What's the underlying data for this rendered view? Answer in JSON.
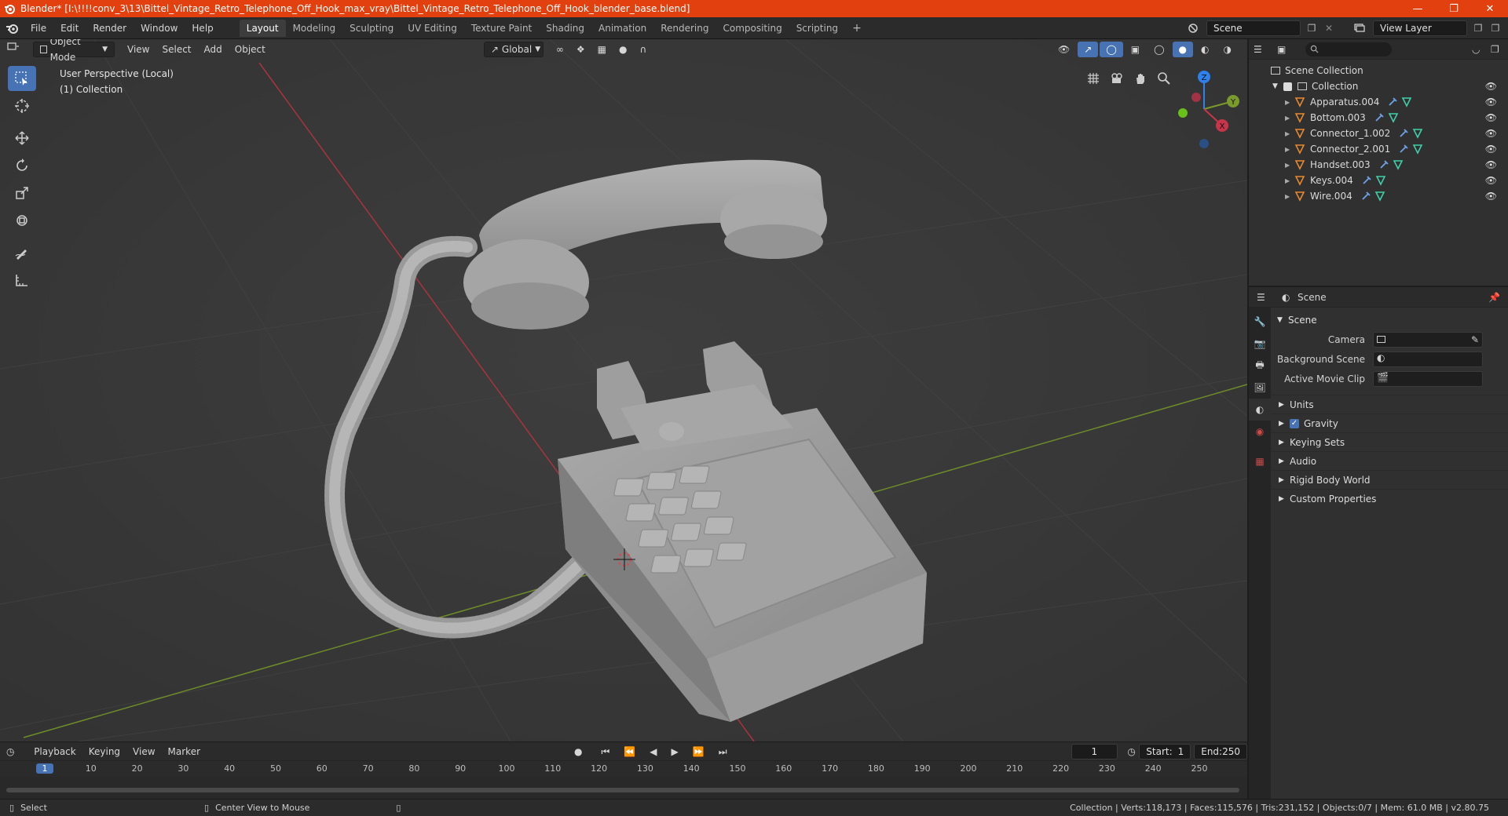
{
  "window": {
    "title": "Blender* [I:\\!!!!conv_3\\13\\Bittel_Vintage_Retro_Telephone_Off_Hook_max_vray\\Bittel_Vintage_Retro_Telephone_Off_Hook_blender_base.blend]"
  },
  "menu": [
    "File",
    "Edit",
    "Render",
    "Window",
    "Help"
  ],
  "workspaces": [
    "Layout",
    "Modeling",
    "Sculpting",
    "UV Editing",
    "Texture Paint",
    "Shading",
    "Animation",
    "Rendering",
    "Compositing",
    "Scripting"
  ],
  "active_workspace": "Layout",
  "scene_name": "Scene",
  "view_layer": "View Layer",
  "viewport": {
    "mode": "Object Mode",
    "menus": [
      "View",
      "Select",
      "Add",
      "Object"
    ],
    "orientation": "Global",
    "info_line1": "User Perspective (Local)",
    "info_line2": "(1) Collection",
    "gizmo": {
      "z": "Z",
      "y": "Y",
      "x": "X"
    }
  },
  "outliner": {
    "root": "Scene Collection",
    "collection": "Collection",
    "objects": [
      "Apparatus.004",
      "Bottom.003",
      "Connector_1.002",
      "Connector_2.001",
      "Handset.003",
      "Keys.004",
      "Wire.004"
    ]
  },
  "properties": {
    "header": "Scene",
    "panel": "Scene",
    "fields": [
      {
        "label": "Camera"
      },
      {
        "label": "Background Scene"
      },
      {
        "label": "Active Movie Clip"
      }
    ],
    "subpanels": [
      "Units",
      "Gravity",
      "Keying Sets",
      "Audio",
      "Rigid Body World",
      "Custom Properties"
    ],
    "gravity_checked": true
  },
  "timeline": {
    "menus": [
      "Playback",
      "Keying",
      "View",
      "Marker"
    ],
    "current_frame": "1",
    "start_label": "Start:",
    "start": "1",
    "end_label": "End:",
    "end": "250",
    "ticks": [
      "1",
      "10",
      "20",
      "30",
      "40",
      "50",
      "60",
      "70",
      "80",
      "90",
      "100",
      "110",
      "120",
      "130",
      "140",
      "150",
      "160",
      "170",
      "180",
      "190",
      "200",
      "210",
      "220",
      "230",
      "240",
      "250"
    ]
  },
  "statusbar": {
    "left1": "Select",
    "left2": "Center View to Mouse",
    "right": "Collection | Verts:118,173 | Faces:115,576 | Tris:231,152 | Objects:0/7 | Mem: 61.0 MB | v2.80.75"
  },
  "colors": {
    "titlebar": "#e2400f",
    "accent": "#4772b3",
    "x_axis": "#c8354a",
    "y_axis": "#7a9a2c",
    "z_axis": "#2e80ec",
    "mesh_icon": "#e7892f",
    "modifier_icon": "#6fa3e8",
    "data_icon": "#3fd0a8"
  }
}
